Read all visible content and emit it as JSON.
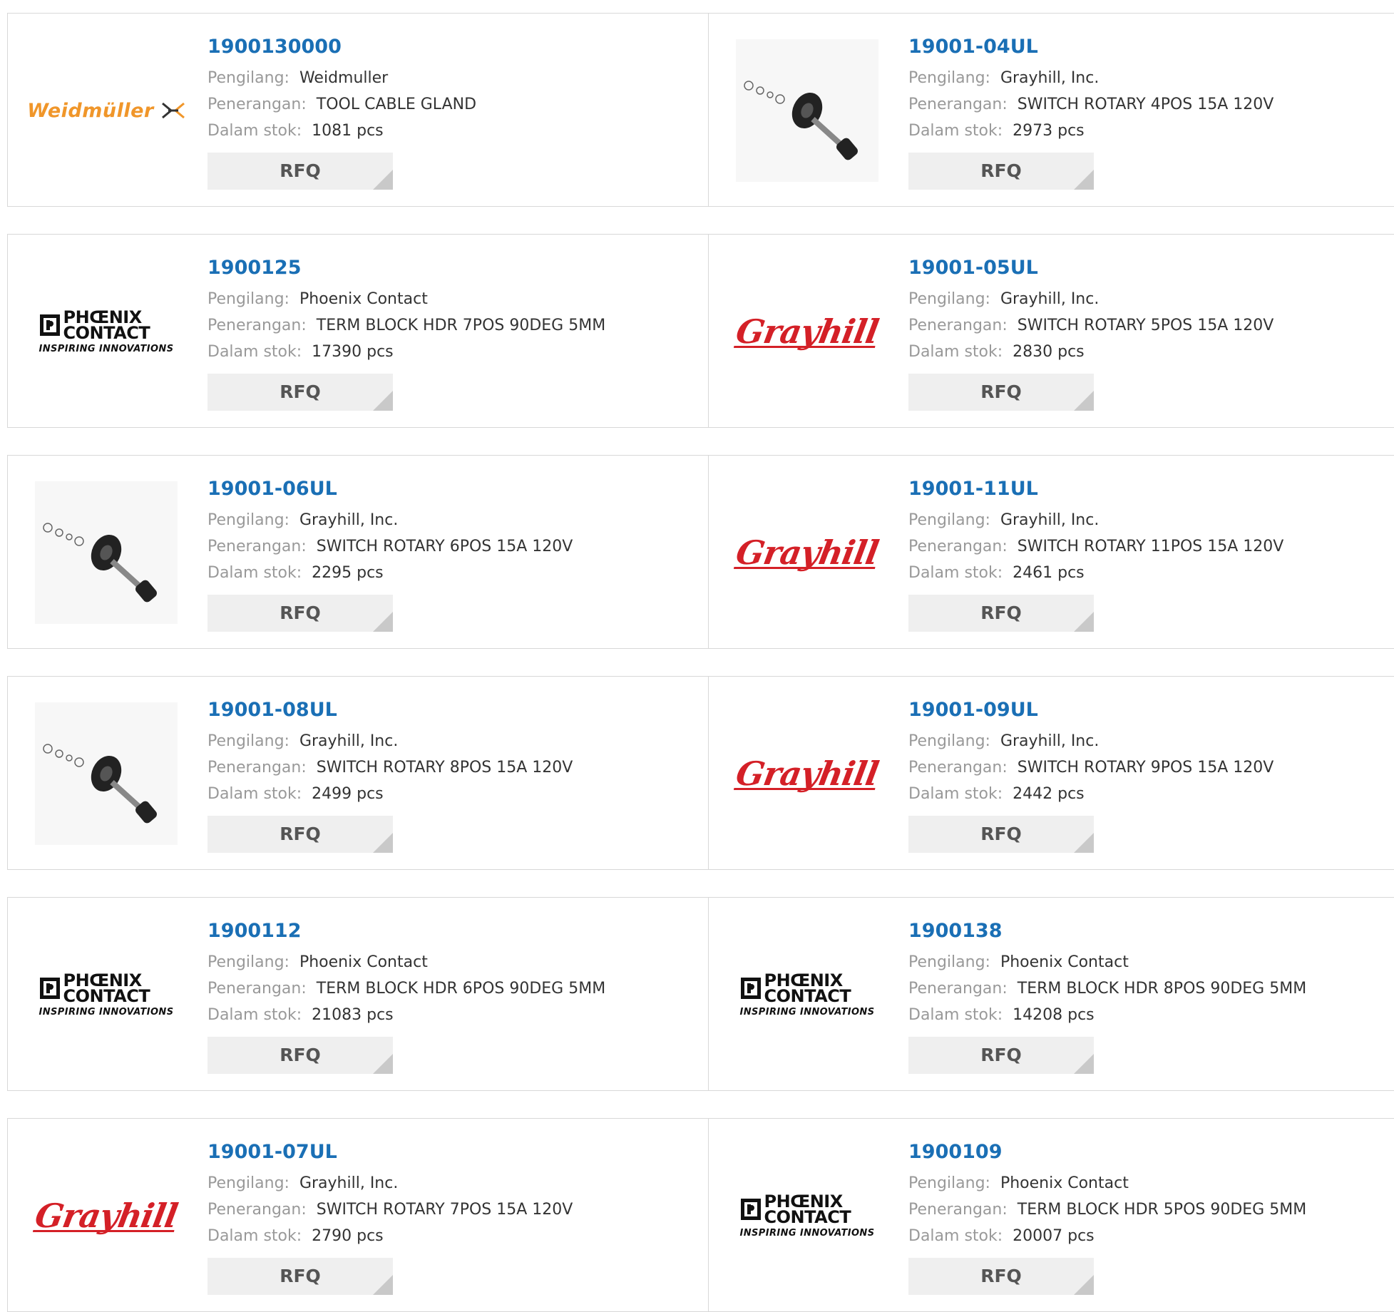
{
  "labels": {
    "manufacturer": "Pengilang:",
    "description": "Penerangan:",
    "stock": "Dalam stok:",
    "rfq": "RFQ"
  },
  "brands": {
    "weidmuller": "Weidmüller",
    "phoenix_line1": "PHŒNIX",
    "phoenix_line2": "CONTACT",
    "phoenix_tagline": "INSPIRING INNOVATIONS",
    "grayhill": "Grayhill"
  },
  "colors": {
    "link": "#1a6fb5",
    "weidmuller_orange": "#f0962a",
    "grayhill_red": "#d42027"
  },
  "products": [
    {
      "part": "1900130000",
      "manufacturer": "Weidmuller",
      "description": "TOOL CABLE GLAND",
      "stock": "1081 pcs",
      "logo": "weidmuller-logo"
    },
    {
      "part": "19001-04UL",
      "manufacturer": "Grayhill, Inc.",
      "description": "SWITCH ROTARY 4POS 15A 120V",
      "stock": "2973 pcs",
      "logo": "rotary-switch-photo"
    },
    {
      "part": "1900125",
      "manufacturer": "Phoenix Contact",
      "description": "TERM BLOCK HDR 7POS 90DEG 5MM",
      "stock": "17390 pcs",
      "logo": "phoenix-contact-logo"
    },
    {
      "part": "19001-05UL",
      "manufacturer": "Grayhill, Inc.",
      "description": "SWITCH ROTARY 5POS 15A 120V",
      "stock": "2830 pcs",
      "logo": "grayhill-logo"
    },
    {
      "part": "19001-06UL",
      "manufacturer": "Grayhill, Inc.",
      "description": "SWITCH ROTARY 6POS 15A 120V",
      "stock": "2295 pcs",
      "logo": "rotary-switch-photo"
    },
    {
      "part": "19001-11UL",
      "manufacturer": "Grayhill, Inc.",
      "description": "SWITCH ROTARY 11POS 15A 120V",
      "stock": "2461 pcs",
      "logo": "grayhill-logo"
    },
    {
      "part": "19001-08UL",
      "manufacturer": "Grayhill, Inc.",
      "description": "SWITCH ROTARY 8POS 15A 120V",
      "stock": "2499 pcs",
      "logo": "rotary-switch-photo"
    },
    {
      "part": "19001-09UL",
      "manufacturer": "Grayhill, Inc.",
      "description": "SWITCH ROTARY 9POS 15A 120V",
      "stock": "2442 pcs",
      "logo": "grayhill-logo"
    },
    {
      "part": "1900112",
      "manufacturer": "Phoenix Contact",
      "description": "TERM BLOCK HDR 6POS 90DEG 5MM",
      "stock": "21083 pcs",
      "logo": "phoenix-contact-logo"
    },
    {
      "part": "1900138",
      "manufacturer": "Phoenix Contact",
      "description": "TERM BLOCK HDR 8POS 90DEG 5MM",
      "stock": "14208 pcs",
      "logo": "phoenix-contact-logo"
    },
    {
      "part": "19001-07UL",
      "manufacturer": "Grayhill, Inc.",
      "description": "SWITCH ROTARY 7POS 15A 120V",
      "stock": "2790 pcs",
      "logo": "grayhill-logo"
    },
    {
      "part": "1900109",
      "manufacturer": "Phoenix Contact",
      "description": "TERM BLOCK HDR 5POS 90DEG 5MM",
      "stock": "20007 pcs",
      "logo": "phoenix-contact-logo"
    }
  ]
}
